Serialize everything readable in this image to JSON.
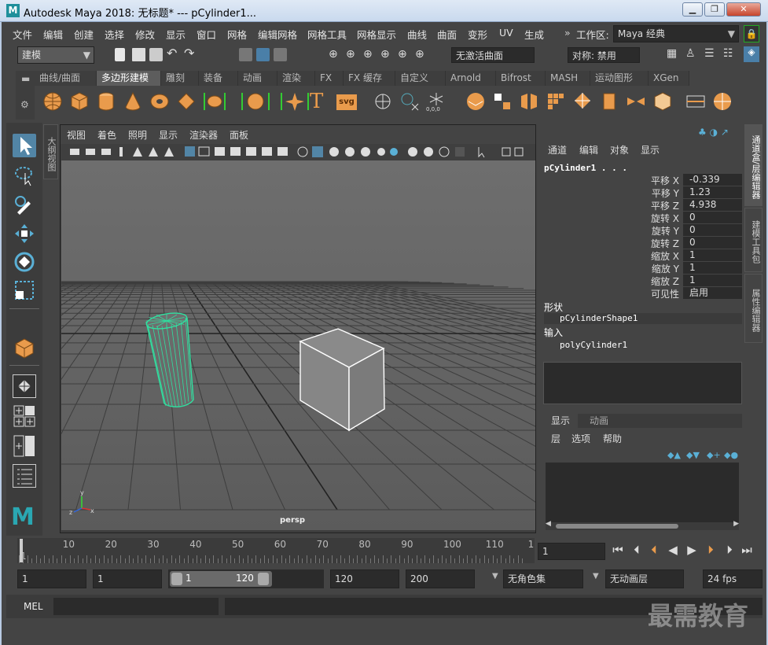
{
  "window": {
    "title": "Autodesk Maya 2018: 无标题*   ---   pCylinder1...",
    "minimize": "▁",
    "maximize": "❐",
    "close": "✕"
  },
  "menubar": {
    "items": [
      "文件",
      "编辑",
      "创建",
      "选择",
      "修改",
      "显示",
      "窗口",
      "网格",
      "编辑网格",
      "网格工具",
      "网格显示",
      "曲线",
      "曲面",
      "变形",
      "UV",
      "生成"
    ],
    "workspace_label": "工作区:",
    "workspace_value": "Maya 经典"
  },
  "statusline": {
    "mode": "建模",
    "no_live_surface": "无激活曲面",
    "symmetry": "对称: 禁用"
  },
  "shelf": {
    "tabs": [
      "曲线/曲面",
      "多边形建模",
      "雕刻",
      "装备",
      "动画",
      "渲染",
      "FX",
      "FX 缓存",
      "自定义",
      "Arnold",
      "Bifrost",
      "MASH",
      "运动图形",
      "XGen"
    ],
    "active_tab": "多边形建模",
    "text_icon": "T",
    "svg_icon": "svg"
  },
  "viewport": {
    "menus": [
      "视图",
      "着色",
      "照明",
      "显示",
      "渲染器",
      "面板"
    ],
    "camera_label": "persp",
    "outliner_tab": "大纲视图"
  },
  "channel_box": {
    "menus": [
      "通道",
      "编辑",
      "对象",
      "显示"
    ],
    "object": "pCylinder1 . . .",
    "attrs": [
      {
        "label": "平移 X",
        "value": "-0.339"
      },
      {
        "label": "平移 Y",
        "value": "1.23"
      },
      {
        "label": "平移 Z",
        "value": "4.938"
      },
      {
        "label": "旋转 X",
        "value": "0"
      },
      {
        "label": "旋转 Y",
        "value": "0"
      },
      {
        "label": "旋转 Z",
        "value": "0"
      },
      {
        "label": "缩放 X",
        "value": "1"
      },
      {
        "label": "缩放 Y",
        "value": "1"
      },
      {
        "label": "缩放 Z",
        "value": "1"
      },
      {
        "label": "可见性",
        "value": "启用"
      }
    ],
    "shape_header": "形状",
    "shape_name": "pCylinderShape1",
    "input_header": "输入",
    "input_name": "polyCylinder1"
  },
  "layer_editor": {
    "tabs": [
      "显示",
      "动画"
    ],
    "menus": [
      "层",
      "选项",
      "帮助"
    ]
  },
  "side_tabs": [
    "通道盒/层编辑器",
    "建模工具包",
    "属性编辑器"
  ],
  "timeline": {
    "ticks": [
      "1",
      "10",
      "20",
      "30",
      "40",
      "50",
      "60",
      "70",
      "80",
      "90",
      "100",
      "110",
      "1"
    ],
    "current_frame": "1"
  },
  "range": {
    "start": "1",
    "inner_start": "1",
    "slider_start": "1",
    "slider_end": "120",
    "end": "120",
    "max": "200",
    "char_set": "无角色集",
    "anim_layer": "无动画层",
    "fps": "24 fps"
  },
  "cmdline": {
    "label": "MEL"
  },
  "watermark": "最需教育"
}
